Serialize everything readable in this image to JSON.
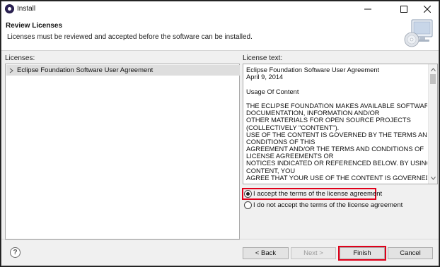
{
  "window": {
    "title": "Install"
  },
  "banner": {
    "title": "Review Licenses",
    "subtitle": "Licenses must be reviewed and accepted before the software can be installed."
  },
  "licenses": {
    "label": "Licenses:",
    "items": [
      {
        "label": "Eclipse Foundation Software User Agreement"
      }
    ]
  },
  "license_text": {
    "label": "License text:",
    "lines": [
      "Eclipse Foundation Software User Agreement",
      "April 9, 2014",
      "",
      "Usage Of Content",
      "",
      "THE ECLIPSE FOUNDATION MAKES AVAILABLE SOFTWARE,",
      "DOCUMENTATION, INFORMATION AND/OR",
      "OTHER MATERIALS FOR OPEN SOURCE PROJECTS",
      "(COLLECTIVELY \"CONTENT\").",
      "USE OF THE CONTENT IS GOVERNED BY THE TERMS AND",
      "CONDITIONS OF THIS",
      "AGREEMENT AND/OR THE TERMS AND CONDITIONS OF",
      "LICENSE AGREEMENTS OR",
      "NOTICES INDICATED OR REFERENCED BELOW.  BY USING THE",
      "CONTENT, YOU",
      "AGREE THAT YOUR USE OF THE CONTENT IS GOVERNED BY THIS"
    ]
  },
  "radios": {
    "accept": {
      "label": "I accept the terms of the license agreement",
      "checked": true
    },
    "decline": {
      "label": "I do not accept the terms of the license agreement",
      "checked": false
    }
  },
  "buttons": {
    "help": "?",
    "back": "< Back",
    "next": "Next >",
    "finish": "Finish",
    "cancel": "Cancel"
  },
  "icons": {
    "app": "eclipse-icon",
    "minimize": "minimize-icon",
    "maximize": "maximize-icon",
    "close": "close-icon",
    "banner": "install-computer-icon",
    "tree_expand": "chevron-right-icon",
    "scroll_up": "scroll-up-icon",
    "scroll_down": "scroll-down-icon",
    "help": "help-icon"
  },
  "colors": {
    "highlight": "#e0001a",
    "tree_selection": "#dedede"
  }
}
